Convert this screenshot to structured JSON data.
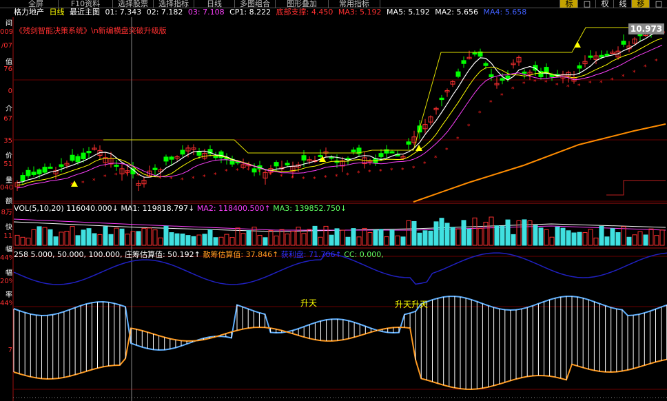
{
  "toolbar": {
    "buttons": [
      "全屏",
      "F10资料",
      "选择股票",
      "选择指标",
      "日线",
      "多图组合",
      "图形叠加",
      "常用指标"
    ],
    "right_buttons": [
      {
        "label": "标",
        "active": true
      },
      {
        "label": "□",
        "active": false
      },
      {
        "label": "权",
        "active": false
      },
      {
        "label": "线",
        "active": false
      },
      {
        "label": "移",
        "active": true
      },
      {
        "label": "□",
        "active": false
      }
    ]
  },
  "header": {
    "stock_name": "格力地产",
    "period": "日线",
    "main_chart": "最近主图",
    "items": [
      {
        "label": "01: 7.343",
        "color": "#ffffff"
      },
      {
        "label": "02: 7.182",
        "color": "#ffffff"
      },
      {
        "label": "03: 7.108",
        "color": "#ff40ff"
      },
      {
        "label": "CP1: 8.222",
        "color": "#ffffff"
      },
      {
        "label": "底部支撑: 4.450",
        "color": "#ff3030"
      },
      {
        "label": "MA3: 5.192",
        "color": "#ff3030"
      },
      {
        "label": "MA5: 5.192",
        "color": "#ffffff"
      },
      {
        "label": "MA2: 5.656",
        "color": "#ffffff"
      },
      {
        "label": "MA4: 5.658",
        "color": "#4060ff"
      }
    ]
  },
  "system_title": "《残剑智能决策系统》\\n新编横盘突破升级版",
  "price_tag": "10.973",
  "left_labels": [
    "间",
    "009",
    "/07",
    "值",
    "76",
    "0",
    "介",
    "67",
    "35",
    "价",
    "51",
    "量",
    "040",
    "额",
    "8万",
    "快",
    "11",
    "幅",
    "44%",
    "幅",
    "20%",
    "率",
    "44%",
    "7"
  ],
  "volume_line": {
    "name": "VOL(5,10,20)",
    "value": "116040.000↓",
    "ma1": "MA1: 119818.797↓",
    "ma2": "MA2: 118400.500↑",
    "ma3": "MA3: 139852.750↓"
  },
  "chip_line": {
    "prefix": "258",
    "params": "5.000, 50.000, 100.000,",
    "zhuang": "庄筹估算值: 50.192↑",
    "san": "散筹估算值: 37.846↑",
    "extra": "获利盘: 71.706↑",
    "cc": "CC: 0.000,"
  },
  "annotations": [
    {
      "text": "升天"
    },
    {
      "text": "升天升天"
    }
  ],
  "colors": {
    "up": "#ff3030",
    "down": "#00ff00",
    "ma1": "#ffffff",
    "ma2": "#ffff00",
    "ma3": "#ff40ff",
    "support": "#ff8c00",
    "blue_line": "#2020c0",
    "cyan_line": "#60b0ff",
    "orange_line": "#ff9a20"
  }
}
